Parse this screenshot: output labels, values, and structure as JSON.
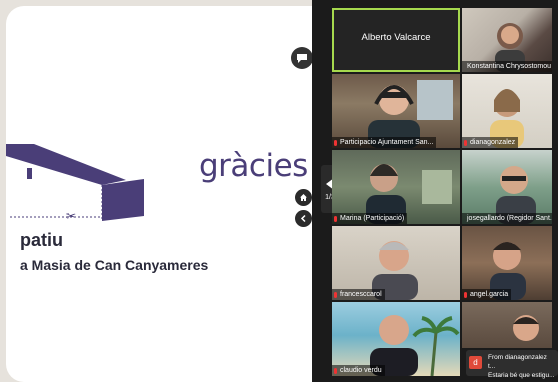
{
  "slide": {
    "thanks": "gràcies!",
    "title_partial": "patiu",
    "subtitle_partial": "a Masia de Can Canyameres"
  },
  "pager": {
    "page": "1/3"
  },
  "gallery": {
    "featured": "Alberto Valcarce",
    "tiles": [
      "Konstantina Chrysostomou",
      "Participacio Ajuntament San...",
      "dianagonzalez",
      "Marina (Participació)",
      "josegallardo (Regidor Sant...",
      "francesccarol",
      "angel.garcia",
      "claudio verdu",
      ""
    ]
  },
  "toast": {
    "avatar_letter": "d",
    "line1": "From dianagonzalez t...",
    "line2": "Estaria bé que estigu..."
  },
  "colors": {
    "accent": "#4a3e78",
    "speaker_border": "#a6d94e",
    "mic_muted": "#ee3333"
  }
}
